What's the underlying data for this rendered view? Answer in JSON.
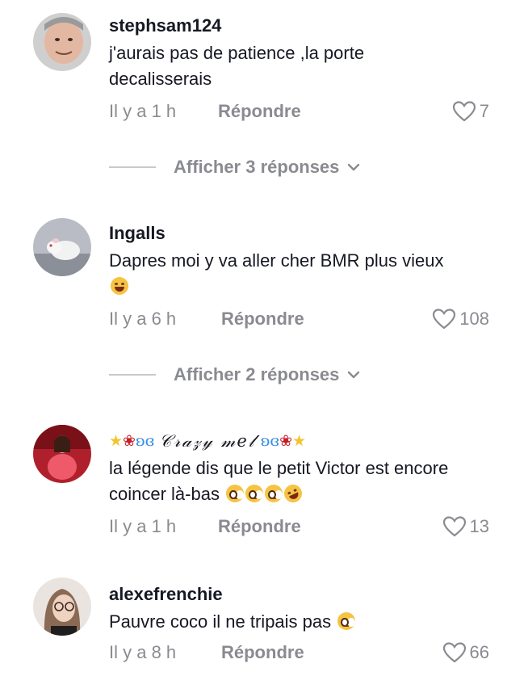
{
  "comments": [
    {
      "username": "stephsam124",
      "text": "j'aurais pas de patience ,la porte decalisserais",
      "time": "Il y a 1 h",
      "reply_label": "Répondre",
      "likes": "7",
      "show_replies": "Afficher 3 réponses"
    },
    {
      "username": "Ingalls",
      "text": "Dapres moi y va aller cher BMR plus vieux",
      "emoji": [
        "laughing-tears-emoji"
      ],
      "time": "Il y a 6 h",
      "reply_label": "Répondre",
      "likes": "108",
      "show_replies": "Afficher 2 réponses"
    },
    {
      "username": "𝒞𝓇𝒶𝓏𝓎 𝓂𝑒𝓁",
      "username_decorations": [
        "star-emoji",
        "rose-emoji",
        "butterfly-emoji"
      ],
      "text": "la légende dis que le petit Victor est encore coincer là-bas",
      "emoji": [
        "pleading-face-emoji",
        "pleading-face-emoji",
        "pleading-face-emoji",
        "rolling-laughing-emoji"
      ],
      "time": "Il y a 1 h",
      "reply_label": "Répondre",
      "likes": "13"
    },
    {
      "username": "alexefrenchie",
      "text": "Pauvre coco il ne tripais pas",
      "emoji": [
        "pleading-face-emoji"
      ],
      "time": "Il y a 8 h",
      "reply_label": "Répondre",
      "likes": "66"
    }
  ],
  "colors": {
    "text": "#161823",
    "secondary": "#8a8b91",
    "divider": "#c8c9cc"
  }
}
